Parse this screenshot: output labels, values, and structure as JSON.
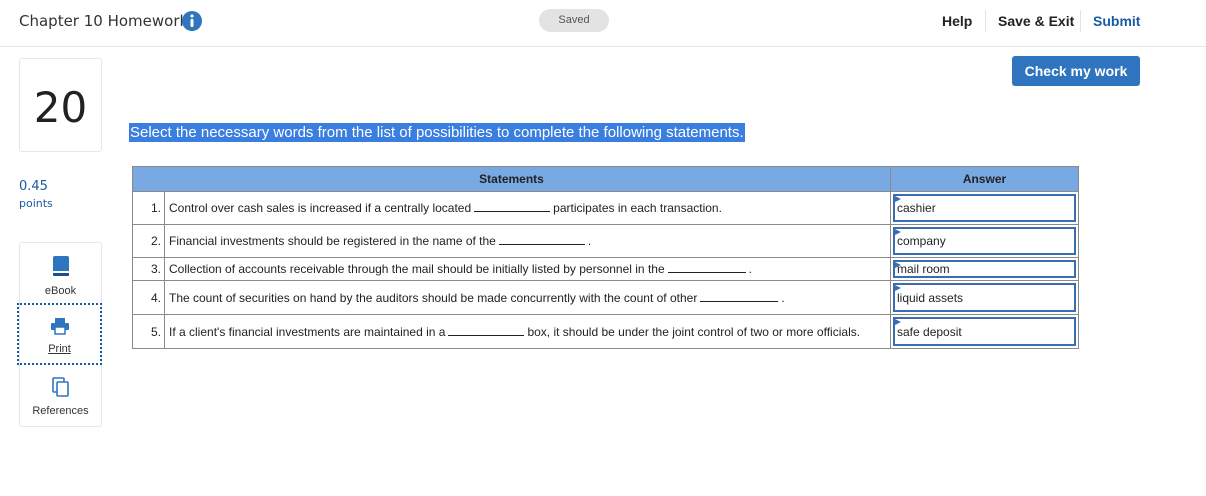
{
  "header": {
    "title": "Chapter 10 Homework",
    "saved_label": "Saved",
    "help_label": "Help",
    "save_exit_label": "Save & Exit",
    "submit_label": "Submit"
  },
  "question": {
    "number": "20",
    "points_value": "0.45",
    "points_label": "points",
    "instruction": "Select the necessary words from the list of possibilities to complete the following statements."
  },
  "tools": {
    "ebook_label": "eBook",
    "print_label": "Print",
    "references_label": "References"
  },
  "check_label": "Check my work",
  "table": {
    "headers": {
      "statements": "Statements",
      "answer": "Answer"
    },
    "rows": [
      {
        "num": "1.",
        "before": "Control over cash sales is increased if a centrally located",
        "after": "participates in each transaction.",
        "answer": "cashier"
      },
      {
        "num": "2.",
        "before": "Financial investments should be registered in the name of the",
        "after": ".",
        "answer": "company"
      },
      {
        "num": "3.",
        "before": "Collection of accounts receivable through the mail should be initially listed by personnel in the",
        "after": ".",
        "answer": "mail room"
      },
      {
        "num": "4.",
        "before": "The count of securities on hand by the auditors should be made concurrently with the count of other",
        "after": ".",
        "answer": "liquid assets"
      },
      {
        "num": "5.",
        "before": "If a client's financial investments are maintained in a",
        "after": "box, it should be under the joint control of two or more officials.",
        "answer": "safe deposit"
      }
    ]
  },
  "colors": {
    "accent": "#2f74bf",
    "table_header": "#79a9e3",
    "highlight": "#3a7ee0"
  }
}
